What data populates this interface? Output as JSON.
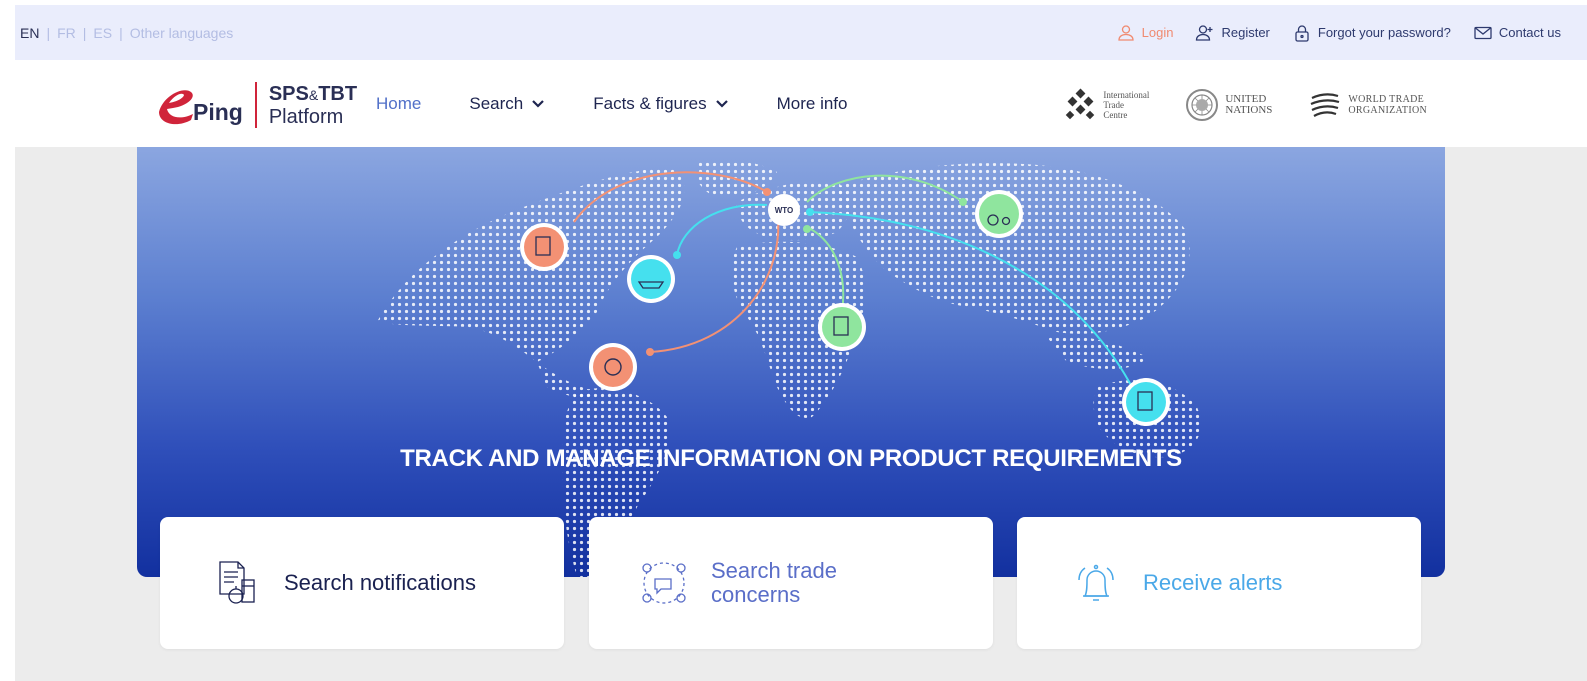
{
  "languages": {
    "active": "EN",
    "fr": "FR",
    "es": "ES",
    "other": "Other languages"
  },
  "utility": {
    "login": "Login",
    "register": "Register",
    "forgot": "Forgot your password?",
    "contact": "Contact us"
  },
  "logo": {
    "ping": "Ping",
    "line1_sps": "SPS",
    "line1_amp": "&",
    "line1_tbt": "TBT",
    "line2": "Platform"
  },
  "nav": {
    "home": "Home",
    "search": "Search",
    "facts": "Facts & figures",
    "more": "More info"
  },
  "partners": {
    "itc": [
      "International",
      "Trade",
      "Centre"
    ],
    "un": [
      "UNITED",
      "NATIONS"
    ],
    "wto": [
      "WORLD TRADE",
      "ORGANIZATION"
    ]
  },
  "hero": {
    "hub_label": "WTO",
    "title": "TRACK AND MANAGE INFORMATION ON PRODUCT REQUIREMENTS"
  },
  "cards": {
    "notifications": "Search notifications",
    "concerns_l1": "Search trade",
    "concerns_l2": "concerns",
    "alerts": "Receive alerts"
  },
  "colors": {
    "accent": "#5170c8",
    "login": "#f08a70",
    "brand_red": "#d0243a",
    "orange_node": "#f39174",
    "green_node": "#8fe59e",
    "cyan_node": "#45e0ee",
    "alert_blue": "#4aa8e8"
  }
}
